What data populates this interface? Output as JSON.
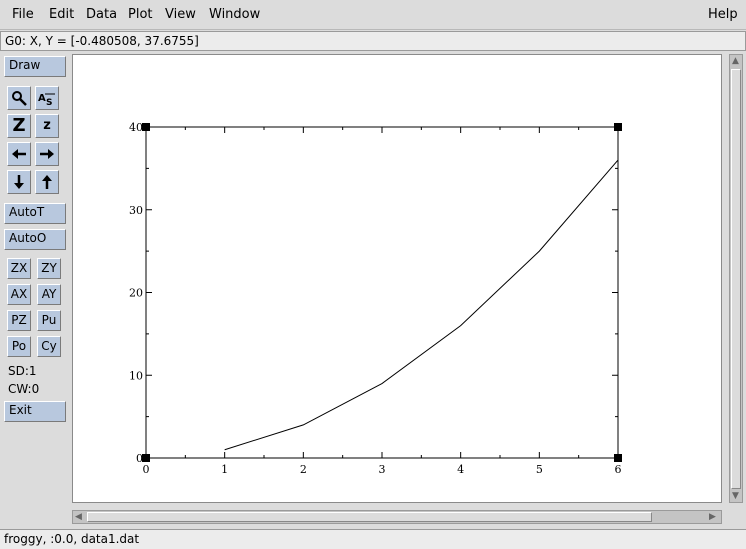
{
  "menu": {
    "file": "File",
    "edit": "Edit",
    "data": "Data",
    "plot": "Plot",
    "view": "View",
    "window": "Window",
    "help": "Help"
  },
  "locator": "G0: X, Y = [-0.480508, 37.6755]",
  "toolbar": {
    "draw": "Draw",
    "autot": "AutoT",
    "autoo": "AutoO",
    "zx": "ZX",
    "zy": "ZY",
    "ax": "AX",
    "ay": "AY",
    "pz": "PZ",
    "pu": "Pu",
    "po": "Po",
    "cy": "Cy",
    "sd": "SD:1",
    "cw": "CW:0",
    "exit": "Exit"
  },
  "icons": [
    "zoom-icon",
    "autoscale-text-icon",
    "zoom-in-icon",
    "zoom-out-icon",
    "arrow-left-icon",
    "arrow-right-icon",
    "arrow-down-icon",
    "arrow-up-icon"
  ],
  "status": "froggy, :0.0, data1.dat",
  "chart_data": {
    "type": "line",
    "x": [
      1,
      2,
      3,
      4,
      5,
      6
    ],
    "series": [
      {
        "values": [
          1,
          4,
          9,
          16,
          25,
          36
        ]
      }
    ],
    "xlim": [
      0,
      6
    ],
    "ylim": [
      0,
      40
    ],
    "xticks": [
      "0",
      "1",
      "2",
      "3",
      "4",
      "5",
      "6"
    ],
    "yticks": [
      "0",
      "10",
      "20",
      "30",
      "40"
    ],
    "line_color": "#000000",
    "grid": false
  }
}
